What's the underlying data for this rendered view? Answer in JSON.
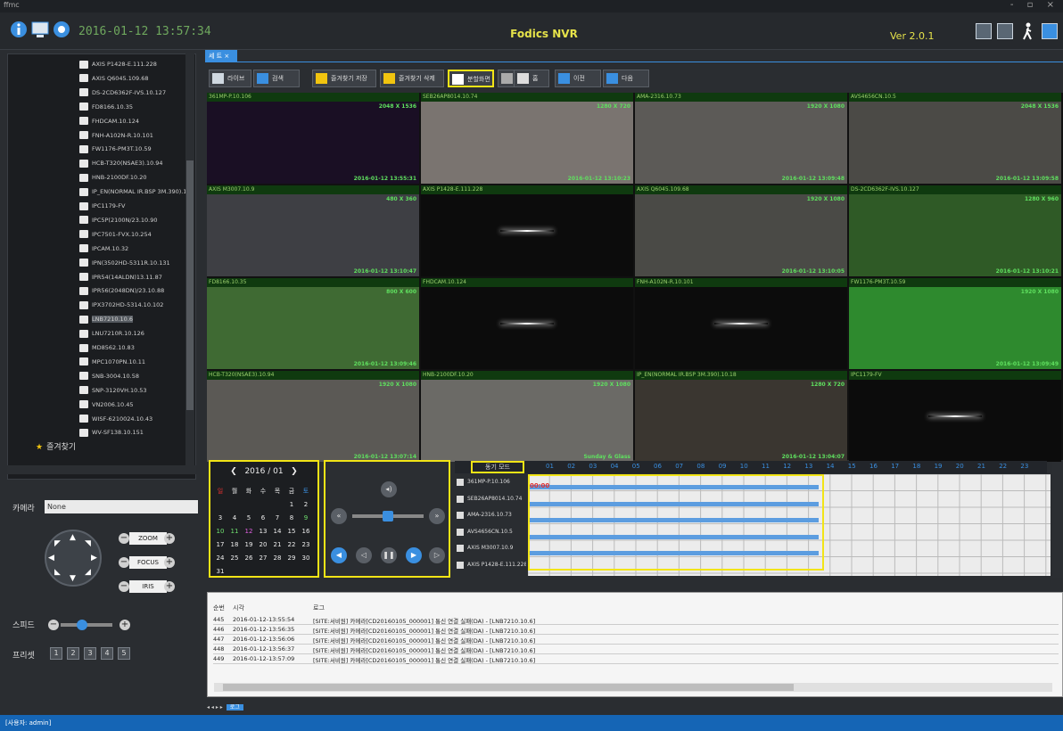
{
  "window": {
    "title": "ffmc",
    "controls": "- ▫ ×"
  },
  "header": {
    "clock": "2016-01-12 13:57:34",
    "app_title": "Fodics NVR",
    "version": "Ver 2.0.1"
  },
  "tree": {
    "items": [
      "AXIS P1428-E.111.228",
      "AXIS Q6045.109.68",
      "DS-2CD6362F-IVS.10.127",
      "FD8166.10.35",
      "FHDCAM.10.124",
      "FNH-A102N-R.10.101",
      "FW1176-PM3T.10.59",
      "HCB-T320(NSAE3).10.94",
      "HNB-2100DF.10.20",
      "IP_EN(NORMAL IR.BSP 3M.390).10.",
      "IPC1179-FV",
      "IPC5P(2100N/23.10.90",
      "IPC7501-FVX.10.254",
      "IPCAM.10.32",
      "IPN(3502HD-5311R.10.131",
      "IPR54(14ALDN)13.11.87",
      "IPR56(2048DN)/23.10.88",
      "IPX3702HD-5314.10.102",
      "LNB7210.10.6",
      "LNU7210R.10.126",
      "MD8562.10.83",
      "MPC1070PN.10.11",
      "SNB-3004.10.58",
      "SNP-3120VH.10.53",
      "VN2006.10.45",
      "WISF-6210024.10.43",
      "WV-SF138.10.151"
    ],
    "selected_index": 18,
    "favorites": "즐겨찾기"
  },
  "left_controls": {
    "camera_label": "카메라",
    "camera_value": "None",
    "zoom": "ZOOM",
    "focus": "FOCUS",
    "iris": "IRIS",
    "speed_label": "스피드",
    "speed_level": 0.3,
    "preset_label": "프리셋",
    "presets": [
      "1",
      "2",
      "3",
      "4",
      "5"
    ]
  },
  "tab": {
    "label": "세 트 ×"
  },
  "toolbar": [
    "라이브",
    "검색",
    "즐겨찾기 저장",
    "즐겨찾기 삭제",
    "분할화면",
    "",
    "홈",
    "이전",
    "다음"
  ],
  "cells": [
    {
      "name": "361MP-P.10.106",
      "res": "2048 X 1536",
      "ts": "2016-01-12 13:55:31",
      "bg": "#1a0f24",
      "hl": true
    },
    {
      "name": "SEB26AP8014.10.74",
      "res": "1280 X 720",
      "ts": "2016-01-12 13:10:23",
      "bg": "#7a7470"
    },
    {
      "name": "AMA-2316.10.73",
      "res": "1920 X 1080",
      "ts": "2016-01-12 13:09:48",
      "bg": "#5c5a57"
    },
    {
      "name": "AVS4656CN.10.5",
      "res": "2048 X 1536",
      "ts": "2016-01-12 13:09:58",
      "bg": "#4b4a46"
    },
    {
      "name": "AXIS M3007.10.9",
      "res": "480 X 360",
      "ts": "2016-01-12 13:10:47",
      "bg": "#3e3f44"
    },
    {
      "name": "AXIS P1428-E.111.228",
      "res": "",
      "ts": "",
      "bg": "#0c0c0c",
      "flare": true
    },
    {
      "name": "AXIS Q6045.109.68",
      "res": "1920 X 1080",
      "ts": "2016-01-12 13:10:05",
      "bg": "#4a4a46"
    },
    {
      "name": "DS-2CD6362F-IVS.10.127",
      "res": "1280 X 960",
      "ts": "2016-01-12 13:10:21",
      "bg": "#2f5a26"
    },
    {
      "name": "FD8166.10.35",
      "res": "800 X 600",
      "ts": "2016-01-12 13:09:46",
      "bg": "#3f6a33"
    },
    {
      "name": "FHDCAM.10.124",
      "res": "",
      "ts": "",
      "bg": "#0c0c0c",
      "flare": true
    },
    {
      "name": "FNH-A102N-R.10.101",
      "res": "",
      "ts": "",
      "bg": "#0c0c0c",
      "flare": true
    },
    {
      "name": "FW1176-PM3T.10.59",
      "res": "1920 X 1080",
      "ts": "2016-01-12 13:09:49",
      "bg": "#2e8a2e"
    },
    {
      "name": "HCB-T320(NSAE3).10.94",
      "res": "1920 X 1080",
      "ts": "2016-01-12 13:07:14",
      "bg": "#5b5955"
    },
    {
      "name": "HNB-2100DF.10.20",
      "res": "1920 X 1080",
      "ts": "Sunday & Glass",
      "bg": "#6b6a66"
    },
    {
      "name": "IP_EN(NORMAL IR.BSP 3M.390).10.18",
      "res": "1280 X 720",
      "ts": "2016-01-12 13:04:07",
      "bg": "#3a3630"
    },
    {
      "name": "IPC1179-FV",
      "res": "",
      "ts": "",
      "bg": "#0c0c0c",
      "flare": true
    }
  ],
  "calendar": {
    "month": "2016 / 01",
    "weekdays": [
      "일",
      "월",
      "화",
      "수",
      "목",
      "금",
      "토"
    ],
    "weeks": [
      [
        "",
        "",
        "",
        "",
        "",
        "1",
        "2"
      ],
      [
        "3",
        "4",
        "5",
        "6",
        "7",
        "8",
        "9"
      ],
      [
        "10",
        "11",
        "12",
        "13",
        "14",
        "15",
        "16"
      ],
      [
        "17",
        "18",
        "19",
        "20",
        "21",
        "22",
        "23"
      ],
      [
        "24",
        "25",
        "26",
        "27",
        "28",
        "29",
        "30"
      ],
      [
        "31",
        "",
        "",
        "",
        "",
        "",
        ""
      ]
    ]
  },
  "timeline": {
    "mode": "동기 모드",
    "cameras": [
      "361MP-P.10.106",
      "SEB26AP8014.10.74",
      "AMA-2316.10.73",
      "AVS4656CN.10.5",
      "AXIS M3007.10.9",
      "AXIS P1428-E.111.228"
    ],
    "hours": [
      "01",
      "02",
      "03",
      "04",
      "05",
      "06",
      "07",
      "08",
      "09",
      "10",
      "11",
      "12",
      "13",
      "14",
      "15",
      "16",
      "17",
      "18",
      "19",
      "20",
      "21",
      "22",
      "23"
    ],
    "now": "00:00"
  },
  "log": {
    "headers": [
      "순번",
      "시각",
      "로그"
    ],
    "rows": [
      [
        "445",
        "2016-01-12-13:55:54",
        "[SITE:서비원] 카메라[CD20160105_000001] 통신 연결 실패(DA) - [LNB7210.10.6]"
      ],
      [
        "446",
        "2016-01-12-13:56:35",
        "[SITE:서비원] 카메라[CD20160105_000001] 통신 연결 실패(DA) - [LNB7210.10.6]"
      ],
      [
        "447",
        "2016-01-12-13:56:06",
        "[SITE:서비원] 카메라[CD20160105_000001] 통신 연결 실패(DA) - [LNB7210.10.6]"
      ],
      [
        "448",
        "2016-01-12-13:56:37",
        "[SITE:서비원] 카메라[CD20160105_000001] 통신 연결 실패(DA) - [LNB7210.10.6]"
      ],
      [
        "449",
        "2016-01-12-13:57:09",
        "[SITE:서비원] 카메라[CD20160105_000001] 통신 연결 실패(DA) - [LNB7210.10.6]"
      ]
    ],
    "tab": "로그"
  },
  "status": "[사용자: admin]",
  "colors": {
    "accent": "#3a8fe0",
    "highlight": "#f2e416",
    "osd": "#5fe05f"
  }
}
